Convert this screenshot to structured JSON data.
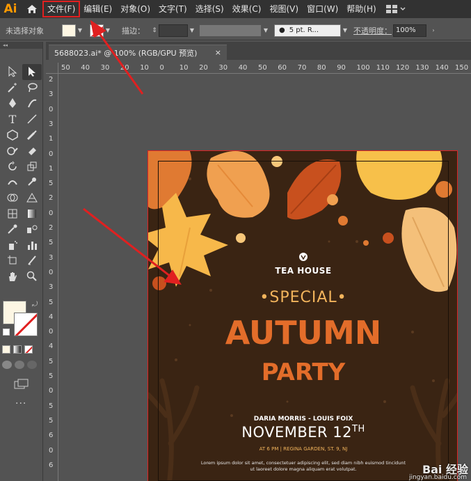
{
  "app": {
    "logo": "Ai",
    "menu": [
      "文件(F)",
      "编辑(E)",
      "对象(O)",
      "文字(T)",
      "选择(S)",
      "效果(C)",
      "视图(V)",
      "窗口(W)",
      "帮助(H)"
    ]
  },
  "controlbar": {
    "selection_status": "未选择对象",
    "stroke_label": "描边：",
    "brush_label": "5 pt. R...",
    "opacity_label": "不透明度：",
    "opacity_value": "100%"
  },
  "tab": {
    "title": "5688023.ai* @ 100% (RGB/GPU 预览)",
    "close": "×"
  },
  "rulers": {
    "horizontal": [
      "50",
      "40",
      "30",
      "20",
      "10",
      "0",
      "10",
      "20",
      "30",
      "40",
      "50",
      "60",
      "70",
      "80",
      "90",
      "100",
      "110",
      "120",
      "130",
      "140",
      "150"
    ],
    "vertical": [
      "2",
      "3",
      "0",
      "3",
      "1",
      "0",
      "1",
      "5",
      "2",
      "0",
      "2",
      "5",
      "3",
      "0",
      "3",
      "5",
      "4",
      "0",
      "4",
      "5",
      "5",
      "0",
      "5",
      "5",
      "6",
      "0",
      "6"
    ]
  },
  "poster": {
    "brand": "TEA HOUSE",
    "special": "•SPECIAL•",
    "headline": "AUTUMN",
    "subheadline": "PARTY",
    "names": "DARIA MORRIS - LOUIS FOIX",
    "date_main": "NOVEMBER 12",
    "date_suffix": "TH",
    "venue": "AT 6 PM | REGINA GARDEN, ST. 9, NJ",
    "lorem": "Lorem ipsum dolor sit amet, consectetuer adipiscing elit, sed diam nibh euismod tincidunt ut laoreet dolore magna aliquam erat volutpat."
  },
  "watermark": {
    "brand": "Bai 经验",
    "url": "jingyan.baidu.com"
  },
  "colors": {
    "menubar": "#323232",
    "panel": "#535353",
    "poster_bg": "#3a2413",
    "accent_orange": "#e36d2a",
    "accent_gold": "#f2b45c",
    "annotation_red": "#e02020"
  }
}
